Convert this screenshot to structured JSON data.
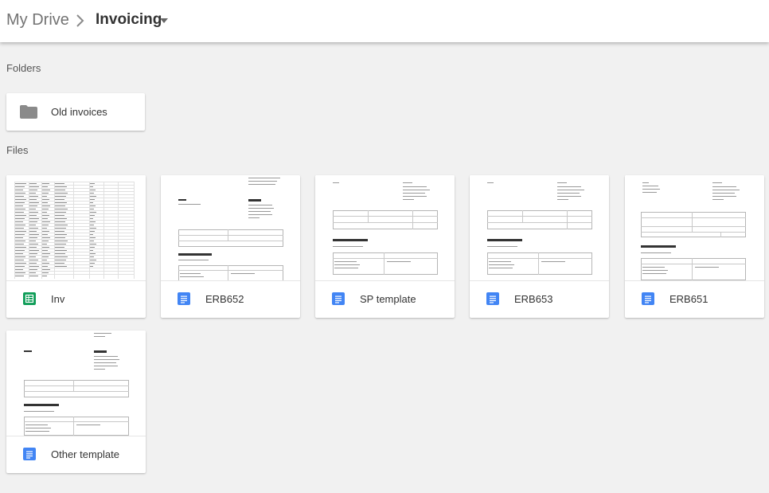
{
  "header": {
    "root_label": "My Drive",
    "current_folder": "Invoicing",
    "separator_icon": "chevron-right-icon",
    "dropdown_icon": "caret-down-icon"
  },
  "folders_section": {
    "label": "Folders",
    "items": [
      {
        "name": "Old invoices",
        "icon": "folder-icon"
      }
    ]
  },
  "files_section": {
    "label": "Files",
    "items": [
      {
        "name": "Inv",
        "type": "spreadsheet",
        "icon": "sheets-icon"
      },
      {
        "name": "ERB652",
        "type": "document",
        "icon": "docs-icon"
      },
      {
        "name": "SP template",
        "type": "document",
        "icon": "docs-icon"
      },
      {
        "name": "ERB653",
        "type": "document",
        "icon": "docs-icon"
      },
      {
        "name": "ERB651",
        "type": "document",
        "icon": "docs-icon"
      },
      {
        "name": "Other template",
        "type": "document",
        "icon": "docs-icon"
      }
    ]
  },
  "colors": {
    "background": "#f1f1f1",
    "sheets_green": "#0f9d58",
    "docs_blue": "#4285f4",
    "folder_gray": "#8a8a8a"
  }
}
